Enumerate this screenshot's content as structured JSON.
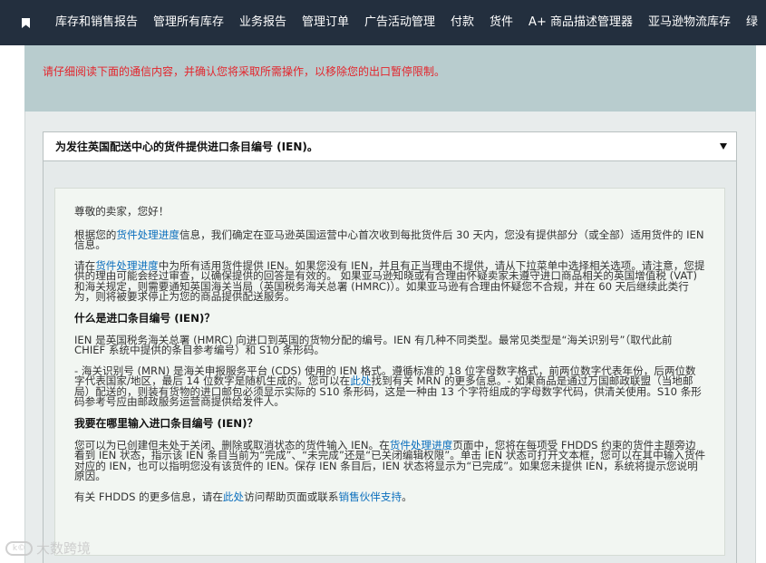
{
  "nav": {
    "items": [
      "库存和销售报告",
      "管理所有库存",
      "业务报告",
      "管理订单",
      "广告活动管理",
      "付款",
      "货件",
      "A+ 商品描述管理器",
      "亚马逊物流库存",
      "绿"
    ]
  },
  "alert": {
    "text": "请仔细阅读下面的通信内容，并确认您将采取所需操作，以移除您的出口暂停限制。",
    "color": "#e3252c"
  },
  "accordion": {
    "title": "为发往英国配送中心的货件提供进口条目编号 (IEN)。",
    "caret_icon": "caret-down-icon"
  },
  "letter": {
    "greeting": "尊敬的卖家，您好！",
    "p1": {
      "pre": "根据您的",
      "link": "货件处理进度",
      "post": "信息，我们确定在亚马逊英国运营中心首次收到每批货件后 30 天内，您没有提供部分（或全部）适用货件的 IEN 信息。"
    },
    "p2": {
      "pre": "请在",
      "link": "货件处理进度",
      "post": "中为所有适用货件提供 IEN。如果您没有 IEN，并且有正当理由不提供，请从下拉菜单中选择相关选项。请注意，您提供的理由可能会经过审查，以确保提供的回答是有效的。 如果亚马逊知晓或有合理由怀疑卖家未遵守进口商品相关的英国增值税 (VAT) 和海关规定，则需要通知英国海关当局（英国税务海关总署 (HMRC)）。如果亚马逊有合理由怀疑您不合规，并在 60 天后继续此类行为，则将被要求停止为您的商品提供配送服务。"
    },
    "h1": "什么是进口条目编号 (IEN)？",
    "p3": "IEN 是英国税务海关总署 (HMRC) 向进口到英国的货物分配的编号。IEN 有几种不同类型。最常见类型是“海关识别号”（取代此前 CHIEF 系统中提供的条目参考编号）和 S10 条形码。",
    "p4": {
      "pre": "- 海关识别号 (MRN) 是海关申报服务平台 (CDS) 使用的 IEN 格式。遵循标准的 18 位字母数字格式，前两位数字代表年份，后两位数字代表国家/地区，最后 14 位数字是随机生成的。您可以在",
      "link": "此处",
      "post": "找到有关 MRN 的更多信息。- 如果商品是通过万国邮政联盟（当地邮局）配送的，则装有货物的进口邮包必须显示实际的 S10 条形码，这是一种由 13 个字符组成的字母数字代码，供清关使用。S10 条形码参考号应由邮政服务运营商提供给发件人。"
    },
    "h2": "我要在哪里输入进口条目编号 (IEN)？",
    "p5": {
      "pre": "您可以为已创建但未处于关闭、删除或取消状态的货件输入 IEN。在",
      "link": "货件处理进度",
      "post": "页面中，您将在每项受 FHDDS 约束的货件主题旁边看到 IEN 状态，指示该 IEN 条目当前为“完成”、“未完成”还是“已关闭编辑权限”。单击 IEN 状态可打开文本框，您可以在其中输入货件对应的 IEN，也可以指明您没有该货件的 IEN。保存 IEN 条目后，IEN 状态将显示为“已完成”。如果您未提供 IEN，系统将提示您说明原因。"
    },
    "p6": {
      "pre": "有关 FHDDS 的更多信息，请在",
      "link1": "此处",
      "mid": "访问帮助页面或联系",
      "link2": "销售伙伴支持",
      "post": "。"
    }
  },
  "watermark": {
    "logo_text": "k©",
    "text": "大数跨境"
  },
  "colors": {
    "nav_bg": "#232f3e",
    "alert_bg": "#b8ccce",
    "link": "#0a6ebd"
  }
}
